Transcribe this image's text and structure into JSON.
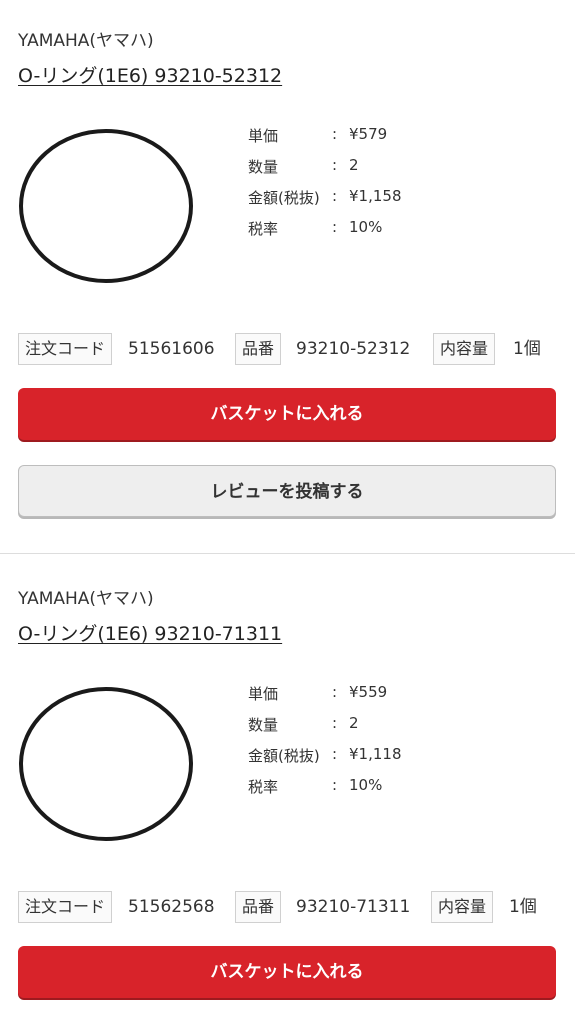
{
  "products": [
    {
      "brand": "YAMAHA(ヤマハ)",
      "title": "O-リング(1E6) 93210-52312",
      "image_icon": "o-ring-image",
      "specs": [
        {
          "label": "単価",
          "colon": ":",
          "value": "¥579"
        },
        {
          "label": "数量",
          "colon": ":",
          "value": "2"
        },
        {
          "label": "金額(税抜)",
          "colon": ":",
          "value": "¥1,158"
        },
        {
          "label": "税率",
          "colon": ":",
          "value": "10%"
        }
      ],
      "meta": {
        "order_code_label": "注文コード",
        "order_code": "51561606",
        "part_no_label": "品番",
        "part_no": "93210-52312",
        "content_label": "内容量",
        "content": "1個"
      },
      "cart_button": "バスケットに入れる",
      "review_button": "レビューを投稿する"
    },
    {
      "brand": "YAMAHA(ヤマハ)",
      "title": "O-リング(1E6) 93210-71311",
      "image_icon": "o-ring-image",
      "specs": [
        {
          "label": "単価",
          "colon": ":",
          "value": "¥559"
        },
        {
          "label": "数量",
          "colon": ":",
          "value": "2"
        },
        {
          "label": "金額(税抜)",
          "colon": ":",
          "value": "¥1,118"
        },
        {
          "label": "税率",
          "colon": ":",
          "value": "10%"
        }
      ],
      "meta": {
        "order_code_label": "注文コード",
        "order_code": "51562568",
        "part_no_label": "品番",
        "part_no": "93210-71311",
        "content_label": "内容量",
        "content": "1個"
      },
      "cart_button": "バスケットに入れる"
    }
  ],
  "colors": {
    "cart_button": "#d8232a",
    "review_button": "#eeeeee",
    "text": "#333333"
  }
}
